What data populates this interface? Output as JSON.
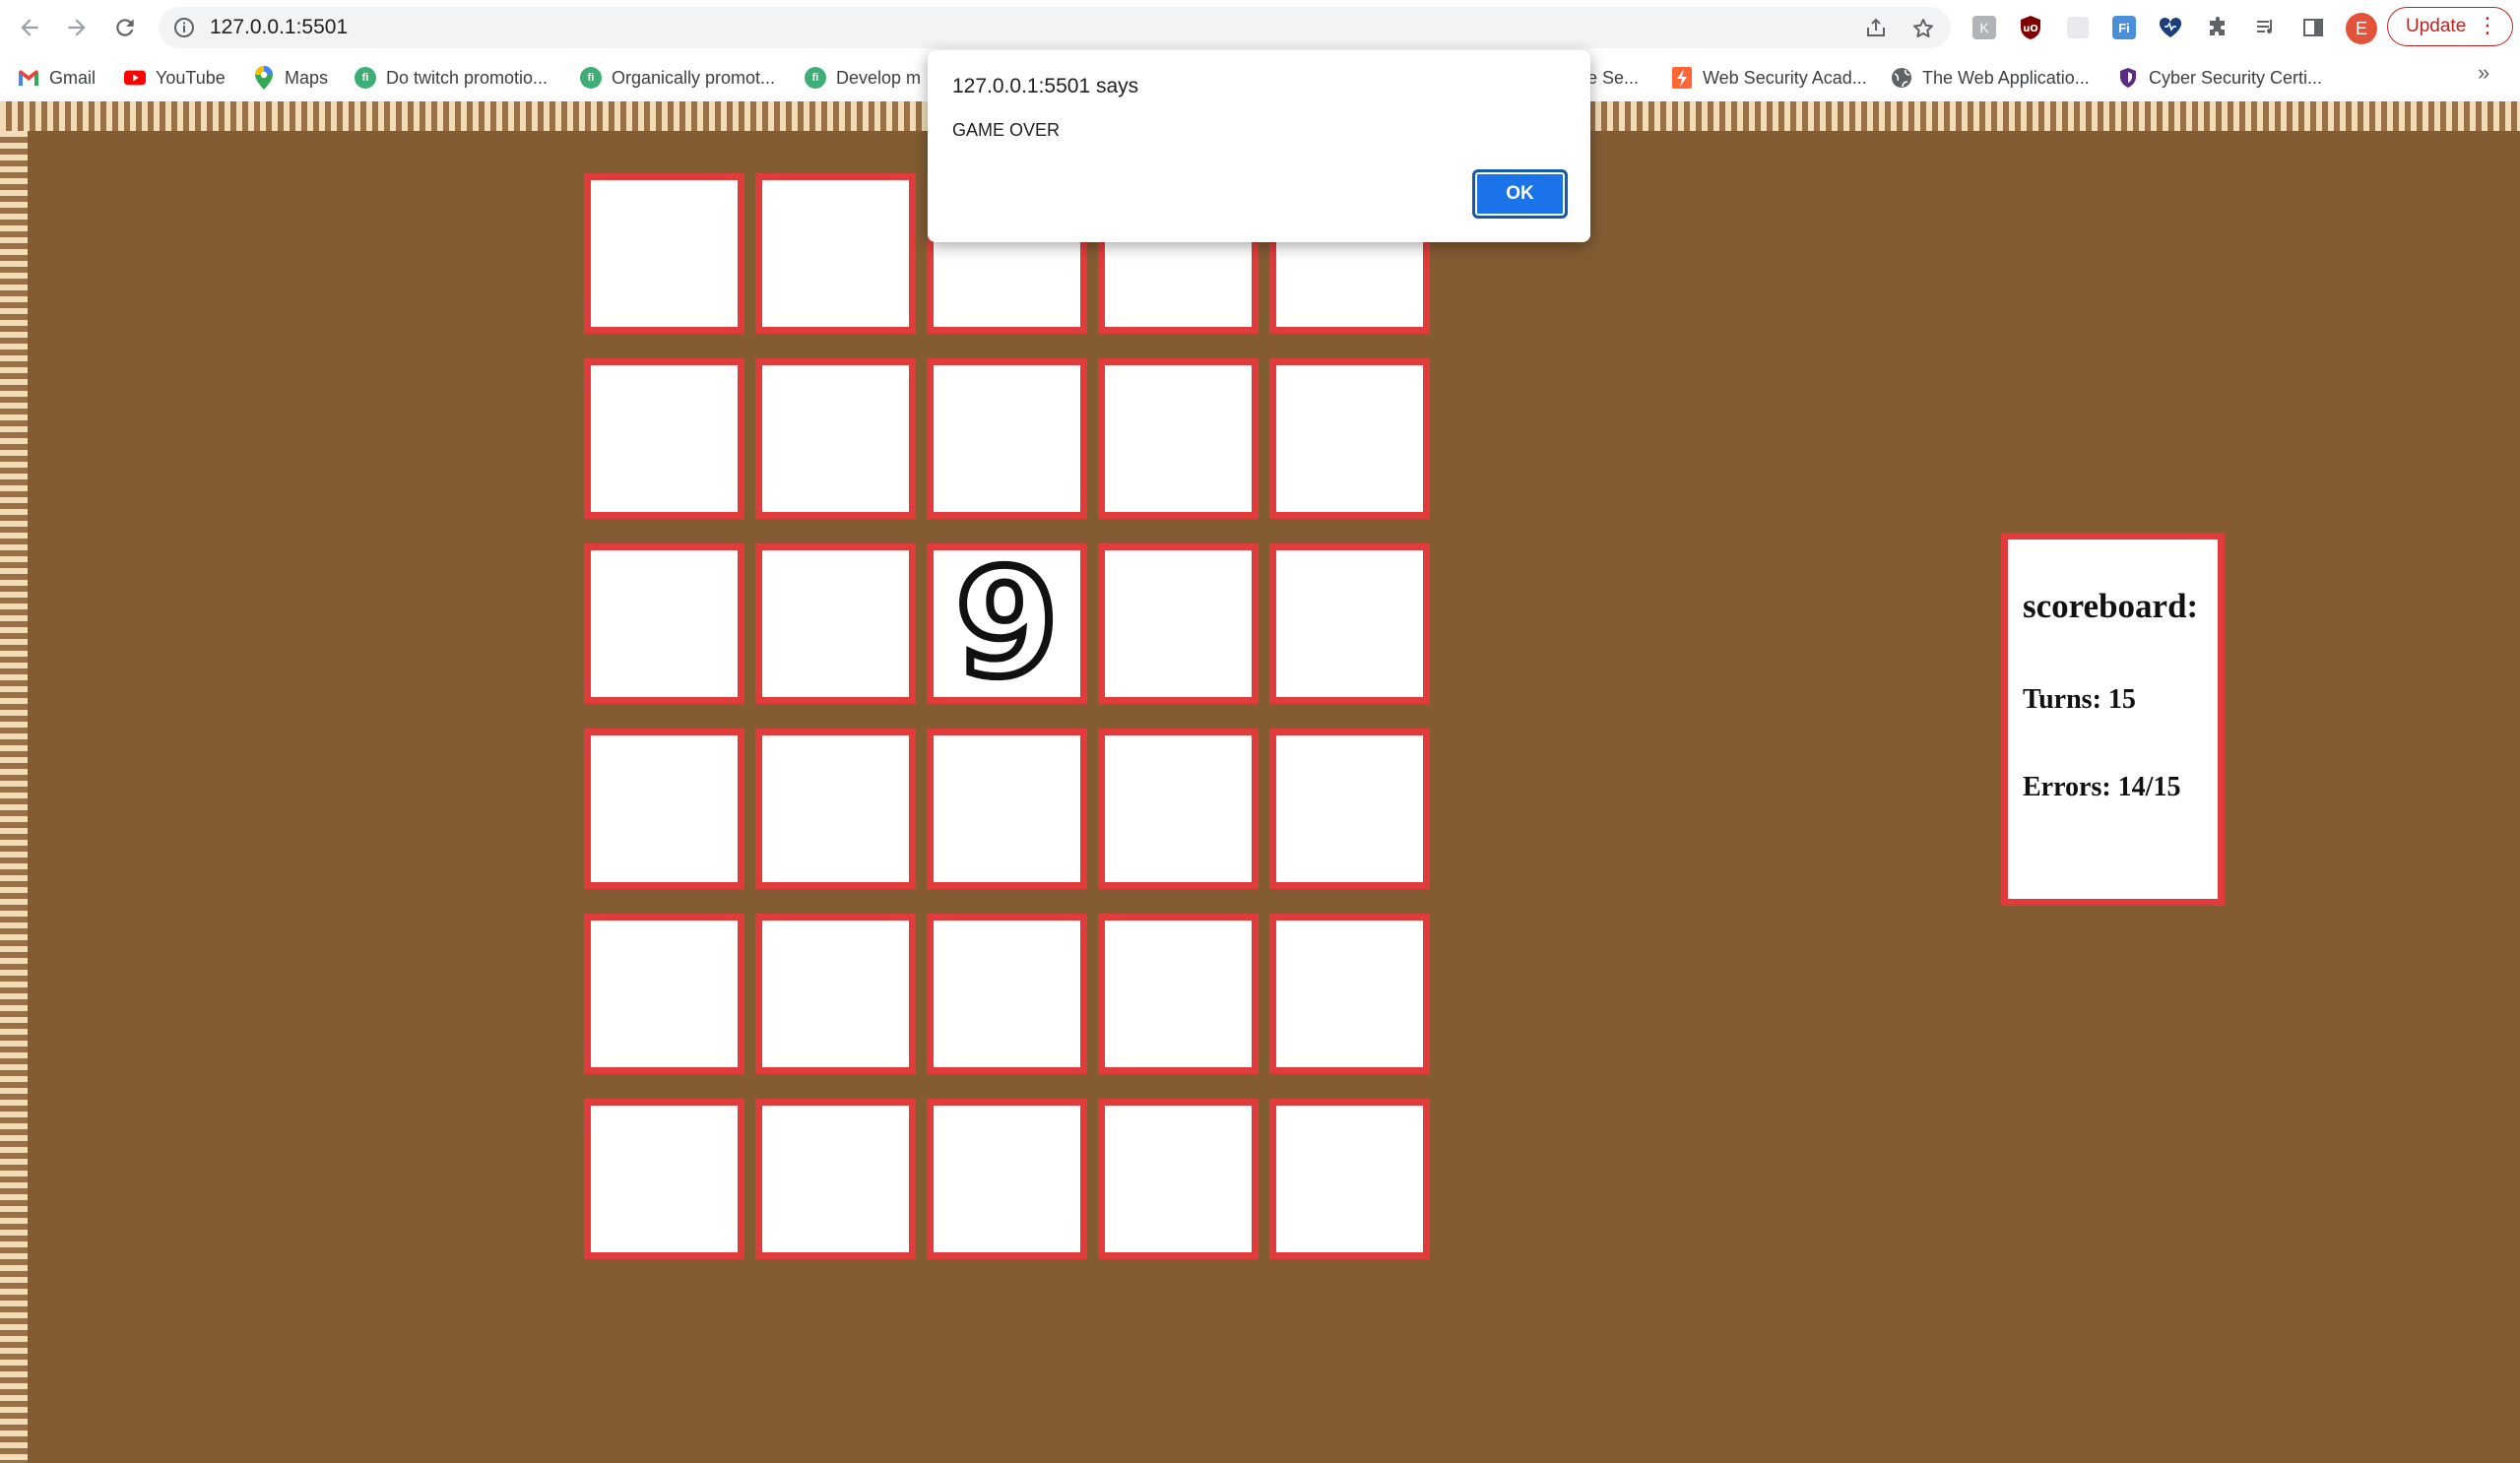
{
  "browser": {
    "url": "127.0.0.1:5501",
    "update_label": "Update",
    "profile_initial": "E",
    "bookmarks": [
      {
        "label": "Gmail",
        "icon": "gmail-icon"
      },
      {
        "label": "YouTube",
        "icon": "youtube-icon"
      },
      {
        "label": "Maps",
        "icon": "maps-icon"
      },
      {
        "label": "Do twitch promotio...",
        "icon": "fi-icon"
      },
      {
        "label": "Organically promot...",
        "icon": "fi-icon"
      },
      {
        "label": "Develop m",
        "icon": "fi-icon"
      },
      {
        "label": "gle Se...",
        "icon": ""
      },
      {
        "label": "Web Security Acad...",
        "icon": "lightning-icon"
      },
      {
        "label": "The Web Applicatio...",
        "icon": "globe-icon"
      },
      {
        "label": "Cyber Security Certi...",
        "icon": "shield-icon"
      }
    ],
    "more_bookmarks": "»"
  },
  "dialog": {
    "title": "127.0.0.1:5501 says",
    "message": "GAME OVER",
    "ok_label": "OK"
  },
  "board": {
    "rows": 6,
    "cols": 5,
    "revealed": [
      {
        "row": 3,
        "col": 3,
        "value": "9"
      }
    ]
  },
  "scoreboard": {
    "title": "scoreboard:",
    "turns": "Turns: 15",
    "errors": "Errors: 14/15"
  },
  "colors": {
    "background": "#845c33",
    "card_border": "#e23b3b",
    "card_face": "#ffffff",
    "ok_button": "#1a73e8"
  }
}
